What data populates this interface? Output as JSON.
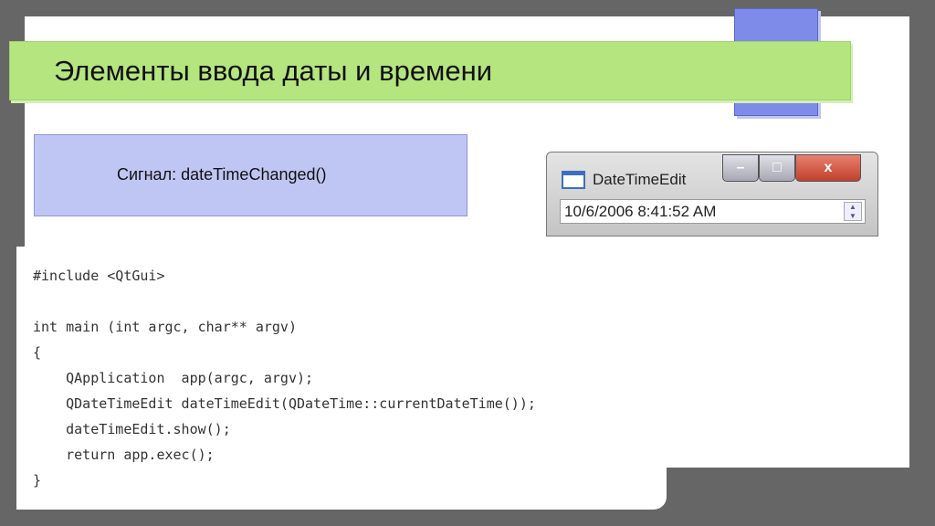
{
  "slide": {
    "title": "Элементы  ввода даты и времени",
    "signal": "Сигнал: dateTimeChanged()"
  },
  "window": {
    "title": "DateTimeEdit",
    "minimize": "–",
    "maximize": "□",
    "close": "x",
    "value": "10/6/2006 8:41:52 AM",
    "spin_up": "▲",
    "spin_down": "▼"
  },
  "code": "#include <QtGui>\n\nint main (int argc, char** argv)\n{\n    QApplication  app(argc, argv);\n    QDateTimeEdit dateTimeEdit(QDateTime::currentDateTime());\n    dateTimeEdit.show();\n    return app.exec();\n}"
}
